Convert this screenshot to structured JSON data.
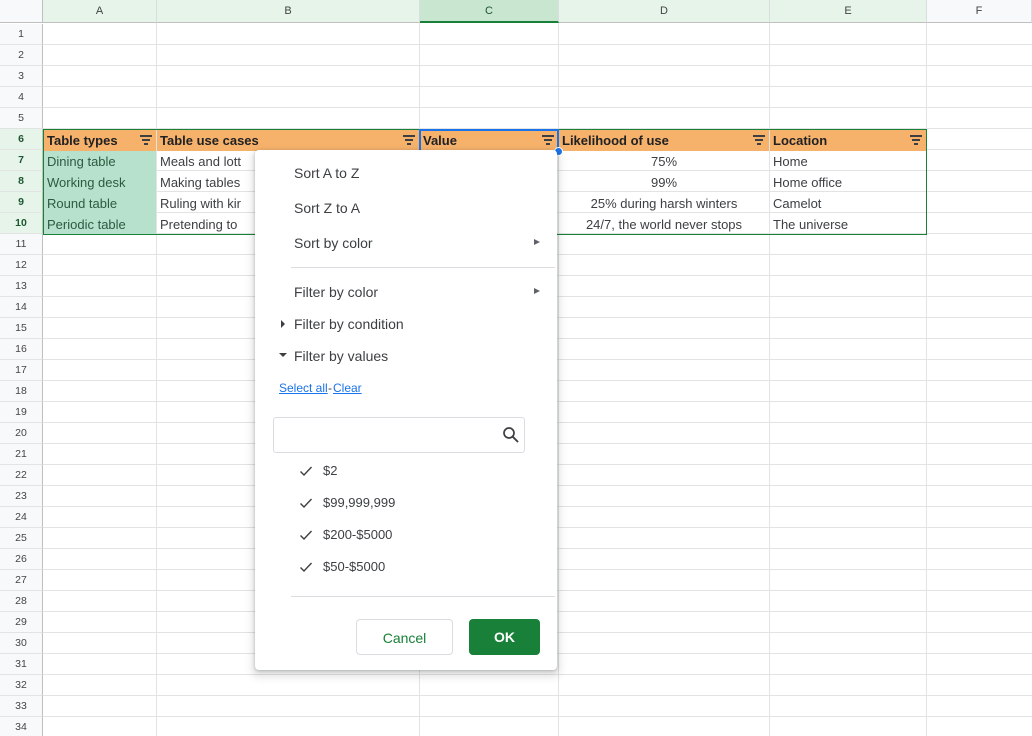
{
  "columns": [
    "A",
    "B",
    "C",
    "D",
    "E",
    "F"
  ],
  "rows": [
    "1",
    "2",
    "3",
    "4",
    "5",
    "6",
    "7",
    "8",
    "9",
    "10",
    "11",
    "12",
    "13",
    "14",
    "15",
    "16",
    "17",
    "18",
    "19",
    "20",
    "21",
    "22",
    "23",
    "24",
    "25",
    "26",
    "27",
    "28",
    "29",
    "30",
    "31",
    "32",
    "33",
    "34"
  ],
  "table": {
    "headers": [
      "Table types",
      "Table use cases",
      "Value",
      "Likelihood of use",
      "Location"
    ],
    "data": [
      [
        "Dining table",
        "Meals and lott",
        "",
        "75%",
        "Home"
      ],
      [
        "Working desk",
        "Making tables",
        "",
        "99%",
        "Home office"
      ],
      [
        "Round table",
        "Ruling with kir",
        "",
        "25% during harsh winters",
        "Camelot"
      ],
      [
        "Periodic table",
        "Pretending to",
        "",
        "24/7, the world never stops",
        "The universe"
      ]
    ]
  },
  "menu": {
    "sort_az": "Sort A to Z",
    "sort_za": "Sort Z to A",
    "sort_color": "Sort by color",
    "filter_color": "Filter by color",
    "filter_condition": "Filter by condition",
    "filter_values": "Filter by values",
    "select_all": "Select all",
    "separator": "-",
    "clear": "Clear",
    "search_placeholder": "",
    "values": [
      "$2",
      "$99,999,999",
      "$200-$5000",
      "$50-$5000"
    ],
    "cancel": "Cancel",
    "ok": "OK"
  },
  "colors": {
    "header_fill": "#f6b26b",
    "first_col_fill": "#b7e1cd",
    "accent_green": "#188038",
    "selection_blue": "#1a73e8"
  }
}
